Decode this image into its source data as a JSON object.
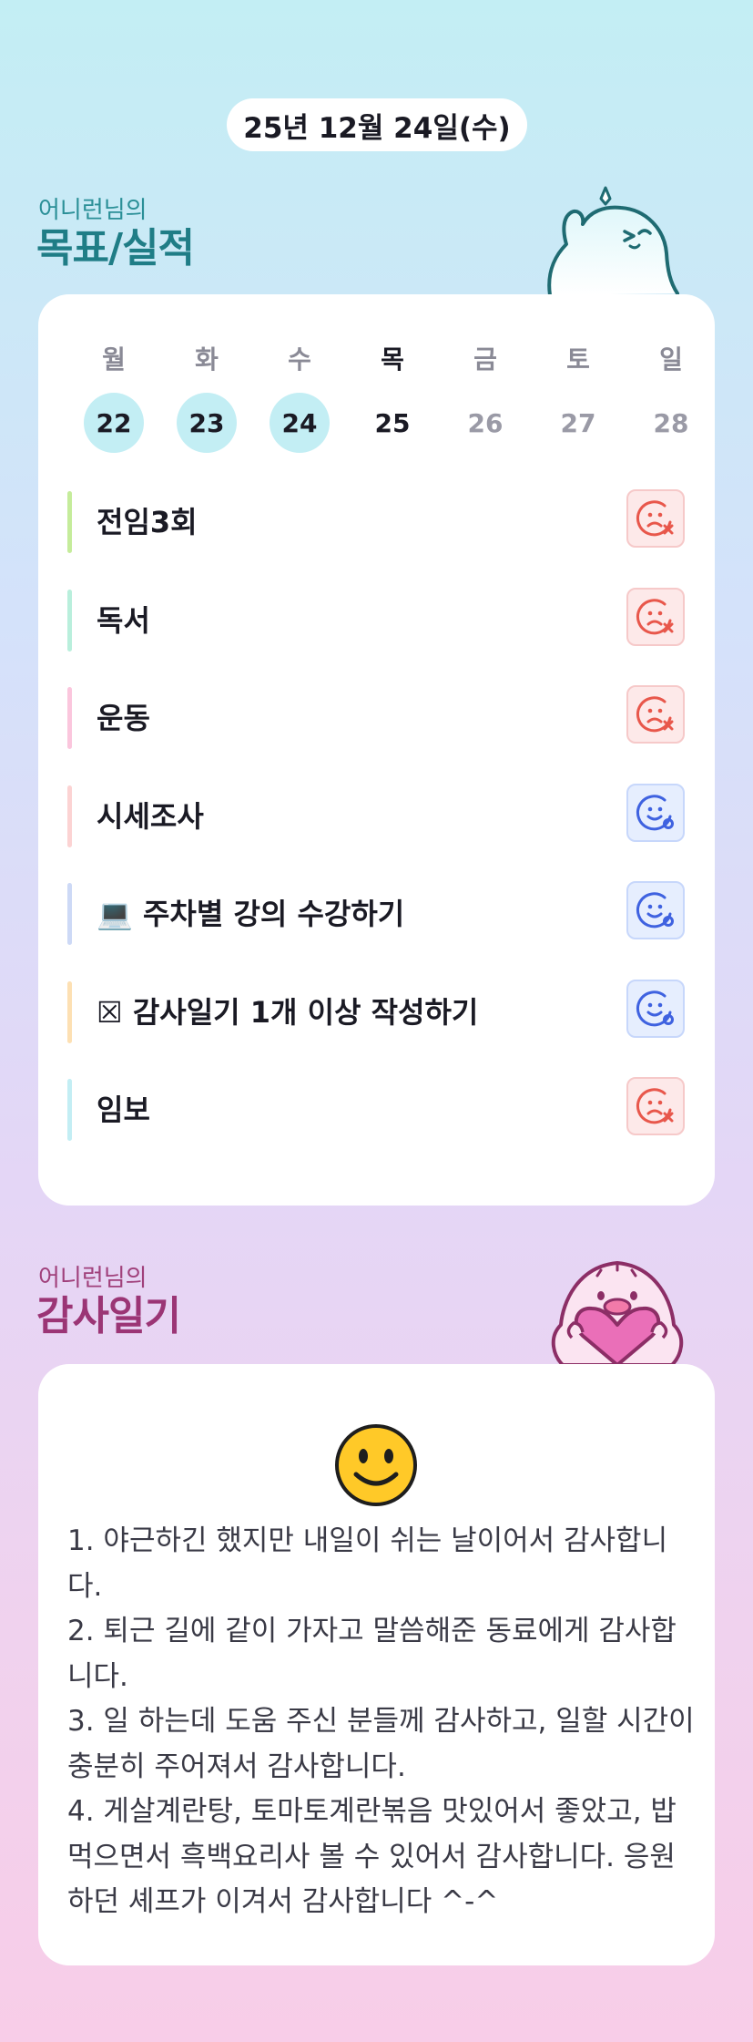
{
  "date_label": "25년 12월 24일(수)",
  "goals_section": {
    "subtitle": "어니런님의",
    "title": "목표/실적"
  },
  "week": {
    "days": [
      "월",
      "화",
      "수",
      "목",
      "금",
      "토",
      "일"
    ],
    "dates": [
      "22",
      "23",
      "24",
      "25",
      "26",
      "27",
      "28"
    ],
    "completed": [
      true,
      true,
      true,
      false,
      false,
      false,
      false
    ],
    "today_index": 3
  },
  "goals": [
    {
      "label": "전임3회",
      "bar_color": "#c5ec9b",
      "result": "fail"
    },
    {
      "label": "독서",
      "bar_color": "#b9efdc",
      "result": "fail"
    },
    {
      "label": "운동",
      "bar_color": "#fbc6dd",
      "result": "fail"
    },
    {
      "label": "시세조사",
      "bar_color": "#fcd3d3",
      "result": "success"
    },
    {
      "label": "💻 주차별 강의 수강하기",
      "bar_color": "#cdd9f6",
      "result": "success"
    },
    {
      "label": "☒ 감사일기 1개 이상 작성하기",
      "bar_color": "#fde0b3",
      "result": "success"
    },
    {
      "label": "임보",
      "bar_color": "#c3eef4",
      "result": "fail"
    }
  ],
  "result_icons": {
    "fail": "sad-face-x-icon",
    "success": "smile-face-check-icon"
  },
  "colors": {
    "fail": "#e8574b",
    "success": "#3f62e0",
    "goal_title": "#1f7d86",
    "gratitude_title": "#9b3575"
  },
  "gratitude_section": {
    "subtitle": "어니런님의",
    "title": "감사일기"
  },
  "gratitude": {
    "emoji_icon": "smiling-face-icon",
    "lines": [
      "1. 야근하긴 했지만 내일이 쉬는 날이어서 감사합니다.",
      "2. 퇴근 길에 같이 가자고 말씀해준 동료에게 감사합니다.",
      "3. 일 하는데 도움 주신 분들께 감사하고, 일할 시간이 충분히 주어져서 감사합니다.",
      "4. 게살계란탕, 토마토계란볶음 맛있어서 좋았고, 밥 먹으면서 흑백요리사 볼 수 있어서 감사합니다. 응원하던 셰프가 이겨서 감사합니다 ^-^"
    ]
  }
}
